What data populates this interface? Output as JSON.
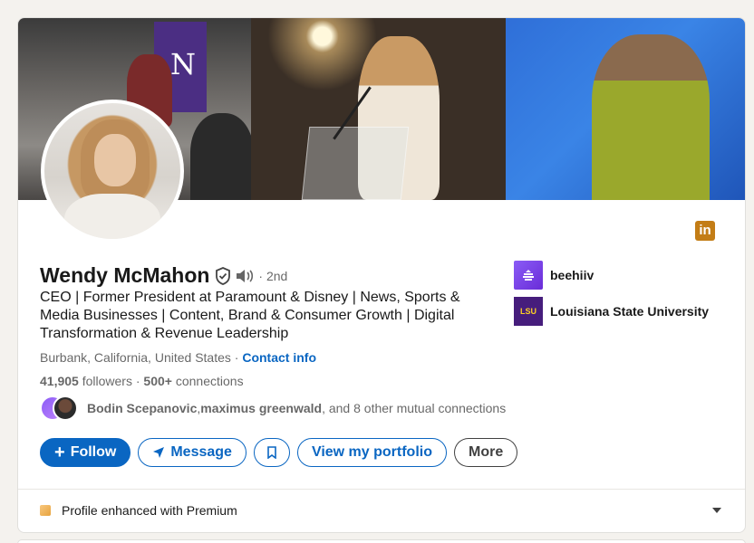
{
  "profile": {
    "name": "Wendy McMahon",
    "degree": "· 2nd",
    "headline": "CEO | Former President at Paramount & Disney | News, Sports & Media Businesses | Content, Brand & Consumer Growth | Digital Transformation & Revenue Leadership",
    "location": "Burbank, California, United States",
    "location_sep": " · ",
    "contact_label": "Contact info",
    "followers_count": "41,905",
    "followers_label": " followers",
    "connections_sep": " · ",
    "connections_count": "500+",
    "connections_label": " connections",
    "mutual_name_1": "Bodin Scepanovic",
    "mutual_sep": ", ",
    "mutual_name_2": "maximus greenwald",
    "mutual_rest": ", and 8 other mutual connections"
  },
  "actions": {
    "follow": "Follow",
    "message": "Message",
    "portfolio": "View my portfolio",
    "more": "More"
  },
  "orgs": [
    {
      "name": "beehiiv"
    },
    {
      "name": "Louisiana State University",
      "logo_text": "LSU"
    }
  ],
  "premium": {
    "label": "Profile enhanced with Premium"
  },
  "banner": {
    "flag_letter": "N"
  },
  "icons": {
    "linkedin_logo": "in"
  },
  "colors": {
    "brand_blue": "#0a66c2",
    "linkedin_gold": "#c37d16",
    "lsu_purple": "#461d7c",
    "beehiiv_purple": "#7c3aed"
  }
}
